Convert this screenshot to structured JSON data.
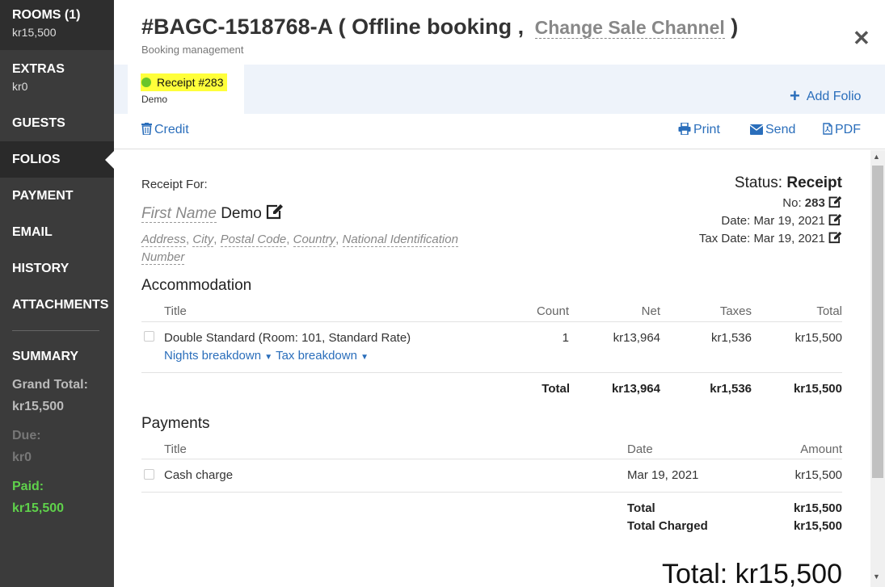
{
  "sidebar": {
    "items": [
      {
        "label": "ROOMS (1)",
        "sub": "kr15,500"
      },
      {
        "label": "EXTRAS",
        "sub": "kr0"
      },
      {
        "label": "GUESTS"
      },
      {
        "label": "FOLIOS"
      },
      {
        "label": "PAYMENT"
      },
      {
        "label": "EMAIL"
      },
      {
        "label": "HISTORY"
      },
      {
        "label": "ATTACHMENTS"
      }
    ],
    "summary": {
      "title": "SUMMARY",
      "grand_total_label": "Grand Total:",
      "grand_total_value": "kr15,500",
      "due_label": "Due:",
      "due_value": "kr0",
      "paid_label": "Paid:",
      "paid_value": "kr15,500"
    },
    "colors": {
      "paid": "#5fd14b",
      "due": "#777777",
      "grand": "#bbbbbb"
    }
  },
  "header": {
    "title": "#BAGC-1518768-A ( Offline booking ,",
    "channel_link": "Change Sale Channel",
    "title_close_paren": ")",
    "subtitle": "Booking management",
    "close_icon": "close-icon"
  },
  "folio_tab": {
    "title": "Receipt #283",
    "subtitle": "Demo",
    "status_color": "#6ac52a",
    "highlight_color": "#ffff3a"
  },
  "add_folio_label": "Add Folio",
  "toolbar": {
    "credit": "Credit",
    "print": "Print",
    "send": "Send",
    "pdf": "PDF"
  },
  "receipt": {
    "for_label": "Receipt For:",
    "first_name_placeholder": "First Name",
    "name": "Demo",
    "address_fields": [
      "Address",
      "City",
      "Postal Code",
      "Country",
      "National Identification"
    ],
    "address_last": "Number",
    "status_label": "Status:",
    "status_value": "Receipt",
    "no_label": "No:",
    "no_value": "283",
    "date_label": "Date:",
    "date_value": "Mar 19, 2021",
    "tax_date_label": "Tax Date:",
    "tax_date_value": "Mar 19, 2021"
  },
  "accommodation": {
    "heading": "Accommodation",
    "columns": [
      "Title",
      "Count",
      "Net",
      "Taxes",
      "Total"
    ],
    "rows": [
      {
        "title": "Double Standard (Room: 101, Standard Rate)",
        "count": "1",
        "net": "kr13,964",
        "taxes": "kr1,536",
        "total": "kr15,500",
        "links": [
          "Nights breakdown",
          "Tax breakdown"
        ]
      }
    ],
    "total_label": "Total",
    "total_net": "kr13,964",
    "total_taxes": "kr1,536",
    "total_total": "kr15,500"
  },
  "payments": {
    "heading": "Payments",
    "columns": [
      "Title",
      "Date",
      "Amount"
    ],
    "rows": [
      {
        "title": "Cash charge",
        "date": "Mar 19, 2021",
        "amount": "kr15,500"
      }
    ],
    "total_label": "Total",
    "total_value": "kr15,500",
    "total_charged_label": "Total Charged",
    "total_charged_value": "kr15,500"
  },
  "grand_total_text": "Total: kr15,500"
}
